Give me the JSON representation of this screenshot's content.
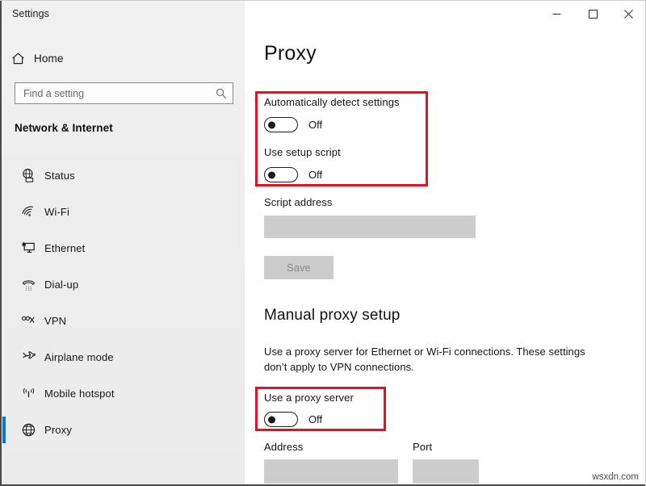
{
  "window": {
    "title": "Settings",
    "controls": {
      "minimize": "─",
      "maximize": "☐",
      "close": "✕"
    }
  },
  "sidebar": {
    "home": {
      "label": "Home",
      "icon": "home-icon"
    },
    "search": {
      "placeholder": "Find a setting",
      "value": "",
      "icon": "search-icon"
    },
    "group_title": "Network & Internet",
    "items": [
      {
        "label": "Status",
        "icon": "status-globe-icon",
        "selected": false
      },
      {
        "label": "Wi-Fi",
        "icon": "wifi-icon",
        "selected": false
      },
      {
        "label": "Ethernet",
        "icon": "ethernet-icon",
        "selected": false
      },
      {
        "label": "Dial-up",
        "icon": "dialup-phone-icon",
        "selected": false
      },
      {
        "label": "VPN",
        "icon": "vpn-icon",
        "selected": false
      },
      {
        "label": "Airplane mode",
        "icon": "airplane-icon",
        "selected": false
      },
      {
        "label": "Mobile hotspot",
        "icon": "hotspot-icon",
        "selected": false
      },
      {
        "label": "Proxy",
        "icon": "proxy-globe-icon",
        "selected": true
      }
    ],
    "accent_color": "#0078d7"
  },
  "main": {
    "page_title": "Proxy",
    "automatic_setup": {
      "auto_detect": {
        "label": "Automatically detect settings",
        "state": "Off",
        "on": false
      },
      "use_setup_script": {
        "label": "Use setup script",
        "state": "Off",
        "on": false
      },
      "script_address": {
        "label": "Script address",
        "value": "",
        "disabled": true
      },
      "save_button": {
        "label": "Save",
        "disabled": true
      }
    },
    "manual_setup": {
      "heading": "Manual proxy setup",
      "description": "Use a proxy server for Ethernet or Wi-Fi connections. These settings don’t apply to VPN connections.",
      "use_proxy_server": {
        "label": "Use a proxy server",
        "state": "Off",
        "on": false
      },
      "address": {
        "label": "Address",
        "value": "",
        "disabled": true
      },
      "port": {
        "label": "Port",
        "value": "",
        "disabled": true
      }
    }
  },
  "annotations": {
    "highlight_color": "#e3111f",
    "boxes": [
      "automatic-proxy-toggles",
      "use-a-proxy-server-toggle"
    ]
  },
  "watermark": "wsxdn.com"
}
